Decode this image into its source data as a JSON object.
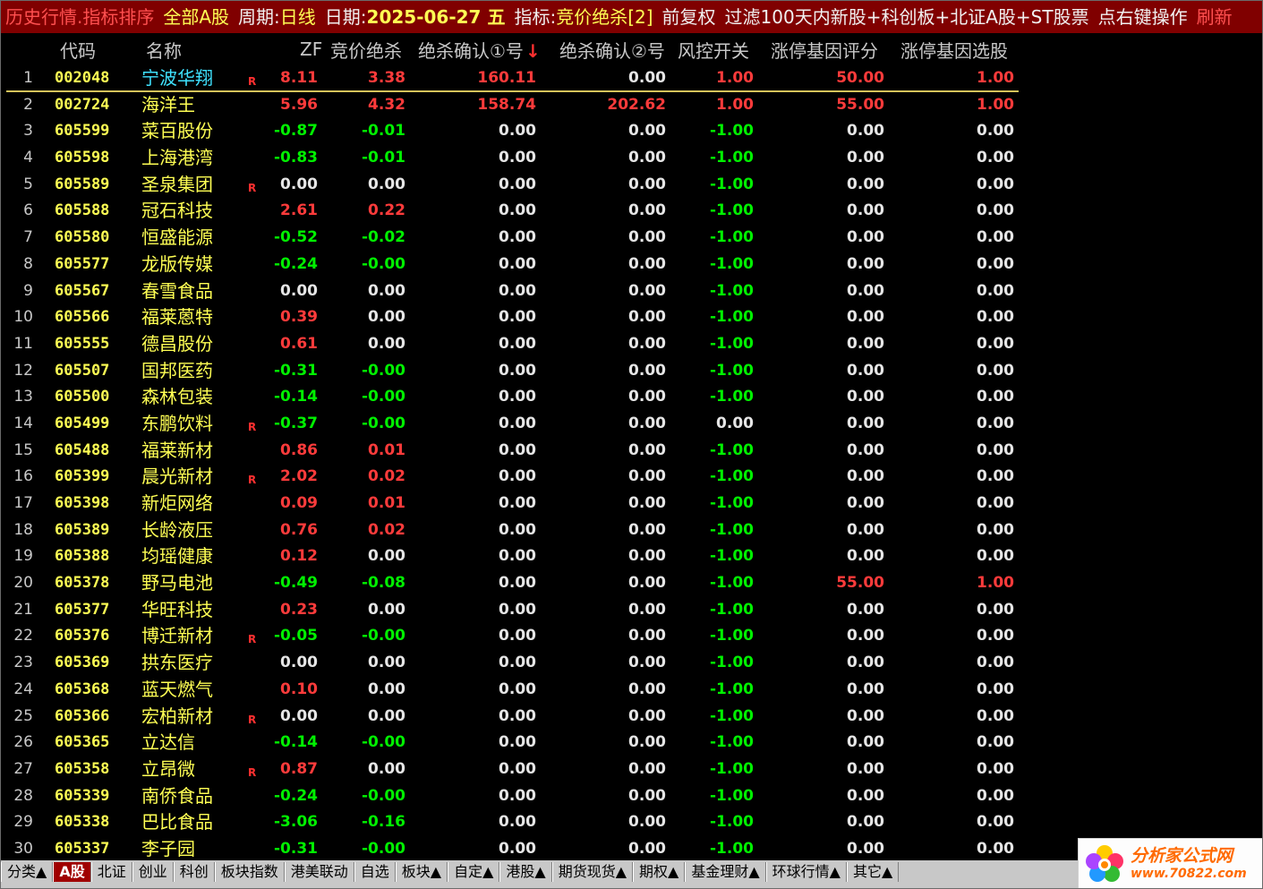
{
  "titlebar": {
    "left_title": "历史行情.指标排序",
    "market": "全部A股",
    "period_label": "周期:",
    "period_value": "日线",
    "date_label": "日期:",
    "date_value": "2025-06-27 五",
    "indicator_label": "指标:",
    "indicator_value": "竞价绝杀[2]",
    "adjust": "前复权",
    "filter": "过滤100天内新股+科创板+北证A股+ST股票",
    "right_click": "点右键操作",
    "refresh": "刷新"
  },
  "columns": {
    "code": "代码",
    "name": "名称",
    "zf": "ZF",
    "jj": "竞价绝杀",
    "qr1": "绝杀确认①号",
    "qr2": "绝杀确认②号",
    "fk": "风控开关",
    "pf": "涨停基因评分",
    "xg": "涨停基因选股"
  },
  "sort_arrow": "↓",
  "rows": [
    {
      "idx": "1",
      "code": "002048",
      "name": "宁波华翔",
      "r": "R",
      "zf": "8.11",
      "jj": "3.38",
      "qr1": "160.11",
      "qr2": "0.00",
      "fk": "1.00",
      "pf": "50.00",
      "xg": "1.00"
    },
    {
      "idx": "2",
      "code": "002724",
      "name": "海洋王",
      "r": "",
      "zf": "5.96",
      "jj": "4.32",
      "qr1": "158.74",
      "qr2": "202.62",
      "fk": "1.00",
      "pf": "55.00",
      "xg": "1.00"
    },
    {
      "idx": "3",
      "code": "605599",
      "name": "菜百股份",
      "r": "",
      "zf": "-0.87",
      "jj": "-0.01",
      "qr1": "0.00",
      "qr2": "0.00",
      "fk": "-1.00",
      "pf": "0.00",
      "xg": "0.00"
    },
    {
      "idx": "4",
      "code": "605598",
      "name": "上海港湾",
      "r": "",
      "zf": "-0.83",
      "jj": "-0.01",
      "qr1": "0.00",
      "qr2": "0.00",
      "fk": "-1.00",
      "pf": "0.00",
      "xg": "0.00"
    },
    {
      "idx": "5",
      "code": "605589",
      "name": "圣泉集团",
      "r": "R",
      "zf": "0.00",
      "jj": "0.00",
      "qr1": "0.00",
      "qr2": "0.00",
      "fk": "-1.00",
      "pf": "0.00",
      "xg": "0.00"
    },
    {
      "idx": "6",
      "code": "605588",
      "name": "冠石科技",
      "r": "",
      "zf": "2.61",
      "jj": "0.22",
      "qr1": "0.00",
      "qr2": "0.00",
      "fk": "-1.00",
      "pf": "0.00",
      "xg": "0.00"
    },
    {
      "idx": "7",
      "code": "605580",
      "name": "恒盛能源",
      "r": "",
      "zf": "-0.52",
      "jj": "-0.02",
      "qr1": "0.00",
      "qr2": "0.00",
      "fk": "-1.00",
      "pf": "0.00",
      "xg": "0.00"
    },
    {
      "idx": "8",
      "code": "605577",
      "name": "龙版传媒",
      "r": "",
      "zf": "-0.24",
      "jj": "-0.00",
      "qr1": "0.00",
      "qr2": "0.00",
      "fk": "-1.00",
      "pf": "0.00",
      "xg": "0.00"
    },
    {
      "idx": "9",
      "code": "605567",
      "name": "春雪食品",
      "r": "",
      "zf": "0.00",
      "jj": "0.00",
      "qr1": "0.00",
      "qr2": "0.00",
      "fk": "-1.00",
      "pf": "0.00",
      "xg": "0.00"
    },
    {
      "idx": "10",
      "code": "605566",
      "name": "福莱蒽特",
      "r": "",
      "zf": "0.39",
      "jj": "0.00",
      "qr1": "0.00",
      "qr2": "0.00",
      "fk": "-1.00",
      "pf": "0.00",
      "xg": "0.00"
    },
    {
      "idx": "11",
      "code": "605555",
      "name": "德昌股份",
      "r": "",
      "zf": "0.61",
      "jj": "0.00",
      "qr1": "0.00",
      "qr2": "0.00",
      "fk": "-1.00",
      "pf": "0.00",
      "xg": "0.00"
    },
    {
      "idx": "12",
      "code": "605507",
      "name": "国邦医药",
      "r": "",
      "zf": "-0.31",
      "jj": "-0.00",
      "qr1": "0.00",
      "qr2": "0.00",
      "fk": "-1.00",
      "pf": "0.00",
      "xg": "0.00"
    },
    {
      "idx": "13",
      "code": "605500",
      "name": "森林包装",
      "r": "",
      "zf": "-0.14",
      "jj": "-0.00",
      "qr1": "0.00",
      "qr2": "0.00",
      "fk": "-1.00",
      "pf": "0.00",
      "xg": "0.00"
    },
    {
      "idx": "14",
      "code": "605499",
      "name": "东鹏饮料",
      "r": "R",
      "zf": "-0.37",
      "jj": "-0.00",
      "qr1": "0.00",
      "qr2": "0.00",
      "fk": "0.00",
      "pf": "0.00",
      "xg": "0.00"
    },
    {
      "idx": "15",
      "code": "605488",
      "name": "福莱新材",
      "r": "",
      "zf": "0.86",
      "jj": "0.01",
      "qr1": "0.00",
      "qr2": "0.00",
      "fk": "-1.00",
      "pf": "0.00",
      "xg": "0.00"
    },
    {
      "idx": "16",
      "code": "605399",
      "name": "晨光新材",
      "r": "R",
      "zf": "2.02",
      "jj": "0.02",
      "qr1": "0.00",
      "qr2": "0.00",
      "fk": "-1.00",
      "pf": "0.00",
      "xg": "0.00"
    },
    {
      "idx": "17",
      "code": "605398",
      "name": "新炬网络",
      "r": "",
      "zf": "0.09",
      "jj": "0.01",
      "qr1": "0.00",
      "qr2": "0.00",
      "fk": "-1.00",
      "pf": "0.00",
      "xg": "0.00"
    },
    {
      "idx": "18",
      "code": "605389",
      "name": "长龄液压",
      "r": "",
      "zf": "0.76",
      "jj": "0.02",
      "qr1": "0.00",
      "qr2": "0.00",
      "fk": "-1.00",
      "pf": "0.00",
      "xg": "0.00"
    },
    {
      "idx": "19",
      "code": "605388",
      "name": "均瑶健康",
      "r": "",
      "zf": "0.12",
      "jj": "0.00",
      "qr1": "0.00",
      "qr2": "0.00",
      "fk": "-1.00",
      "pf": "0.00",
      "xg": "0.00"
    },
    {
      "idx": "20",
      "code": "605378",
      "name": "野马电池",
      "r": "",
      "zf": "-0.49",
      "jj": "-0.08",
      "qr1": "0.00",
      "qr2": "0.00",
      "fk": "-1.00",
      "pf": "55.00",
      "xg": "1.00"
    },
    {
      "idx": "21",
      "code": "605377",
      "name": "华旺科技",
      "r": "",
      "zf": "0.23",
      "jj": "0.00",
      "qr1": "0.00",
      "qr2": "0.00",
      "fk": "-1.00",
      "pf": "0.00",
      "xg": "0.00"
    },
    {
      "idx": "22",
      "code": "605376",
      "name": "博迁新材",
      "r": "R",
      "zf": "-0.05",
      "jj": "-0.00",
      "qr1": "0.00",
      "qr2": "0.00",
      "fk": "-1.00",
      "pf": "0.00",
      "xg": "0.00"
    },
    {
      "idx": "23",
      "code": "605369",
      "name": "拱东医疗",
      "r": "",
      "zf": "0.00",
      "jj": "0.00",
      "qr1": "0.00",
      "qr2": "0.00",
      "fk": "-1.00",
      "pf": "0.00",
      "xg": "0.00"
    },
    {
      "idx": "24",
      "code": "605368",
      "name": "蓝天燃气",
      "r": "",
      "zf": "0.10",
      "jj": "0.00",
      "qr1": "0.00",
      "qr2": "0.00",
      "fk": "-1.00",
      "pf": "0.00",
      "xg": "0.00"
    },
    {
      "idx": "25",
      "code": "605366",
      "name": "宏柏新材",
      "r": "R",
      "zf": "0.00",
      "jj": "0.00",
      "qr1": "0.00",
      "qr2": "0.00",
      "fk": "-1.00",
      "pf": "0.00",
      "xg": "0.00"
    },
    {
      "idx": "26",
      "code": "605365",
      "name": "立达信",
      "r": "",
      "zf": "-0.14",
      "jj": "-0.00",
      "qr1": "0.00",
      "qr2": "0.00",
      "fk": "-1.00",
      "pf": "0.00",
      "xg": "0.00"
    },
    {
      "idx": "27",
      "code": "605358",
      "name": "立昂微",
      "r": "R",
      "zf": "0.87",
      "jj": "0.00",
      "qr1": "0.00",
      "qr2": "0.00",
      "fk": "-1.00",
      "pf": "0.00",
      "xg": "0.00"
    },
    {
      "idx": "28",
      "code": "605339",
      "name": "南侨食品",
      "r": "",
      "zf": "-0.24",
      "jj": "-0.00",
      "qr1": "0.00",
      "qr2": "0.00",
      "fk": "-1.00",
      "pf": "0.00",
      "xg": "0.00"
    },
    {
      "idx": "29",
      "code": "605338",
      "name": "巴比食品",
      "r": "",
      "zf": "-3.06",
      "jj": "-0.16",
      "qr1": "0.00",
      "qr2": "0.00",
      "fk": "-1.00",
      "pf": "0.00",
      "xg": "0.00"
    },
    {
      "idx": "30",
      "code": "605337",
      "name": "李子园",
      "r": "",
      "zf": "-0.31",
      "jj": "-0.00",
      "qr1": "0.00",
      "qr2": "0.00",
      "fk": "-1.00",
      "pf": "0.00",
      "xg": "0.00"
    }
  ],
  "colors": {
    "title_bg": "#800000",
    "up": "#ff3b3b",
    "down": "#00f000",
    "flat": "#e6e6e6",
    "code": "#ffff54",
    "highlight_name": "#3fe2ff"
  },
  "tabs": [
    "分类▲",
    "A股",
    "北证",
    "创业",
    "科创",
    "板块指数",
    "港美联动",
    "自选",
    "板块▲",
    "自定▲",
    "港股▲",
    "期货现货▲",
    "期权▲",
    "基金理财▲",
    "环球行情▲",
    "其它▲"
  ],
  "active_tab": 1,
  "logo": {
    "icon": "flower-logo-icon",
    "text1": "分析家公式网",
    "text2": "www.70822.com"
  }
}
